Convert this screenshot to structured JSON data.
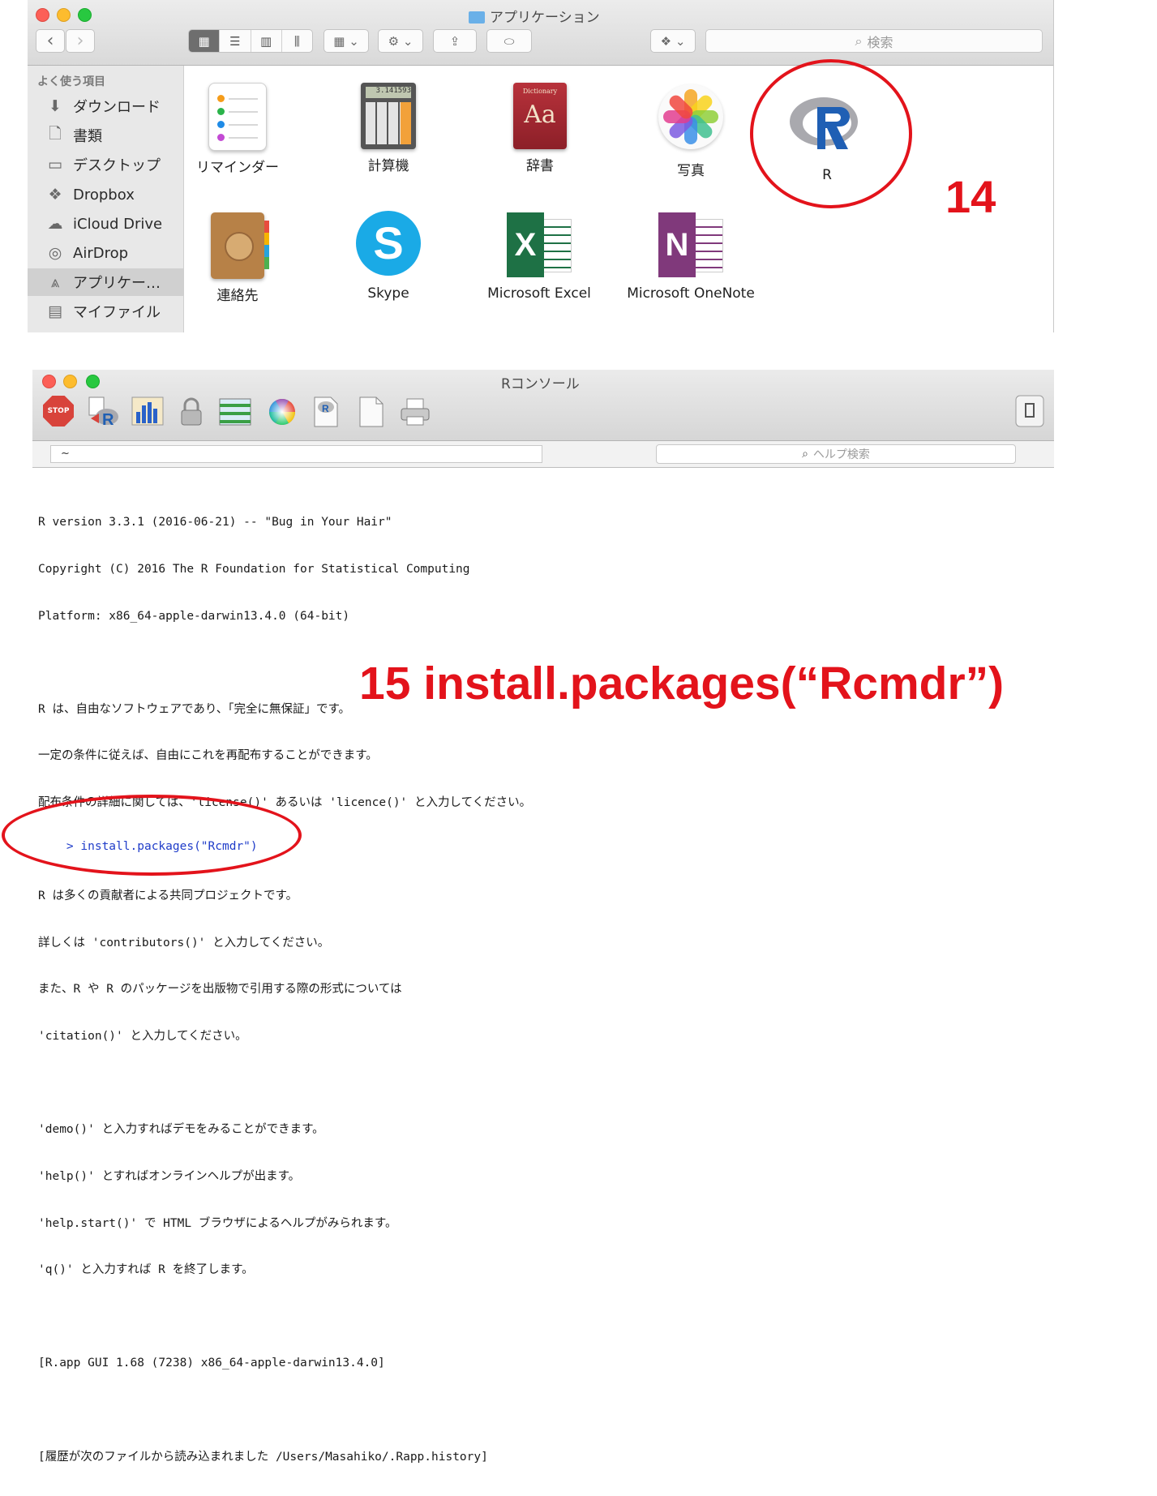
{
  "finder": {
    "title": "アプリケーション",
    "nav_back": "‹",
    "nav_forward": "›",
    "view_icons": "▦",
    "view_list": "☰",
    "view_columns": "▥",
    "view_coverflow": "⫼",
    "arrange_icon": "▦",
    "arrange_chevron": "⌄",
    "action_icon": "⚙",
    "action_chevron": "⌄",
    "share_icon": "⇪",
    "tag_icon": "⬭",
    "dropbox_icon": "❖",
    "dropbox_chevron": "⌄",
    "search_placeholder": "検索",
    "search_icon": "⌕",
    "sidebar": {
      "heading": "よく使う項目",
      "items": [
        {
          "label": "ダウンロード",
          "icon": "⬇"
        },
        {
          "label": "書類",
          "icon": "🗋"
        },
        {
          "label": "デスクトップ",
          "icon": "▭"
        },
        {
          "label": "Dropbox",
          "icon": "❖"
        },
        {
          "label": "iCloud Drive",
          "icon": "☁"
        },
        {
          "label": "AirDrop",
          "icon": "◎"
        },
        {
          "label": "アプリケー…",
          "icon": "⩓"
        },
        {
          "label": "マイファイル",
          "icon": "▤"
        }
      ],
      "selected_index": 6
    },
    "apps": [
      {
        "label": "リマインダー"
      },
      {
        "label": "計算機",
        "display": "3.141593"
      },
      {
        "label": "辞書",
        "cover_small": "Dictionary",
        "cover_big": "Aa"
      },
      {
        "label": "写真"
      },
      {
        "label": "R"
      },
      {
        "label": "連絡先"
      },
      {
        "label": "Skype",
        "glyph": "S"
      },
      {
        "label": "Microsoft Excel",
        "glyph": "X"
      },
      {
        "label": "Microsoft OneNote",
        "glyph": "N"
      }
    ]
  },
  "annotations": {
    "step14": "14",
    "step15": "15 install.packages(“Rcmdr”)",
    "color": "#e3131b"
  },
  "rconsole": {
    "title": "Rコンソール",
    "stop_label": "STOP",
    "path_value": "~",
    "help_search_placeholder": "ヘルプ検索",
    "help_search_icon": "⌕",
    "output_lines": [
      "R version 3.3.1 (2016-06-21) -- \"Bug in Your Hair\"",
      "Copyright (C) 2016 The R Foundation for Statistical Computing",
      "Platform: x86_64-apple-darwin13.4.0 (64-bit)",
      "",
      "R は、自由なソフトウェアであり、「完全に無保証」です。",
      "一定の条件に従えば、自由にこれを再配布することができます。",
      "配布条件の詳細に関しては、'license()' あるいは 'licence()' と入力してください。",
      "",
      "R は多くの貢献者による共同プロジェクトです。",
      "詳しくは 'contributors()' と入力してください。",
      "また、R や R のパッケージを出版物で引用する際の形式については",
      "'citation()' と入力してください。",
      "",
      "'demo()' と入力すればデモをみることができます。",
      "'help()' とすればオンラインヘルプが出ます。",
      "'help.start()' で HTML ブラウザによるヘルプがみられます。",
      "'q()' と入力すれば R を終了します。",
      "",
      "[R.app GUI 1.68 (7238) x86_64-apple-darwin13.4.0]",
      "",
      "[履歴が次のファイルから読み込まれました /Users/Masahiko/.Rapp.history]"
    ],
    "prompt": ">",
    "command": "install.packages(\"Rcmdr\")"
  }
}
